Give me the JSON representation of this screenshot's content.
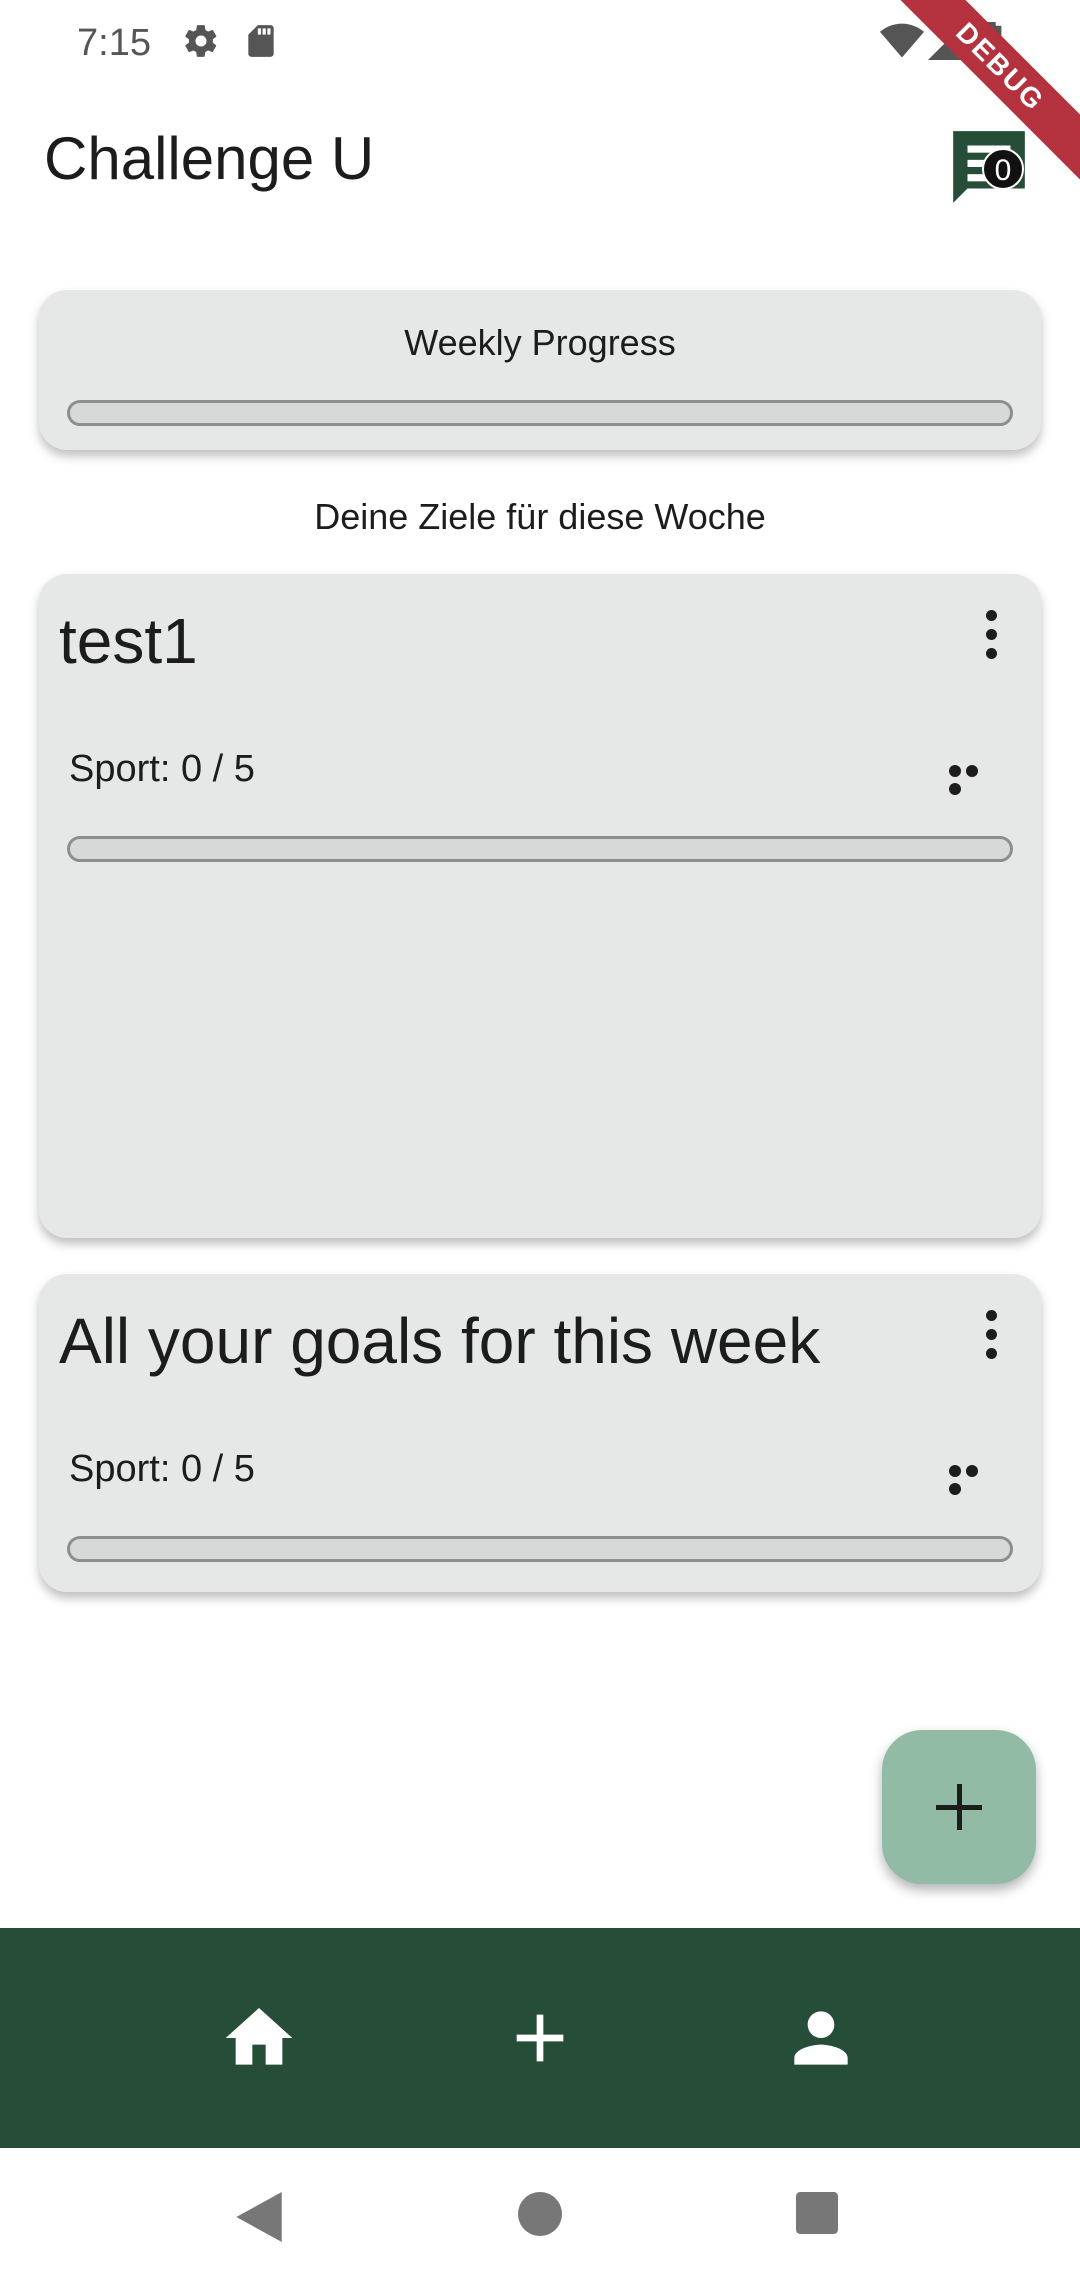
{
  "status_bar": {
    "time": "7:15",
    "icons": [
      "gear-icon",
      "sd-card-icon",
      "wifi-icon",
      "signal-icon",
      "battery-icon"
    ],
    "debug_label": "DEBUG"
  },
  "app_bar": {
    "title": "Challenge U",
    "chat_badge_count": "0"
  },
  "weekly_progress": {
    "title": "Weekly Progress",
    "progress": 0
  },
  "section_heading": "Deine Ziele für diese Woche",
  "goals": [
    {
      "title": "test1",
      "line": "Sport: 0 / 5",
      "progress": 0
    },
    {
      "title": "All your goals for this week",
      "line": "Sport: 0 / 5",
      "progress": 0
    }
  ],
  "bottom_nav": {
    "items": [
      "home-icon",
      "add-icon",
      "person-icon"
    ]
  },
  "colors": {
    "accent": "#264d38",
    "fab": "#92bba6",
    "card": "#e6e8e8",
    "debug_banner": "#b3323e"
  }
}
